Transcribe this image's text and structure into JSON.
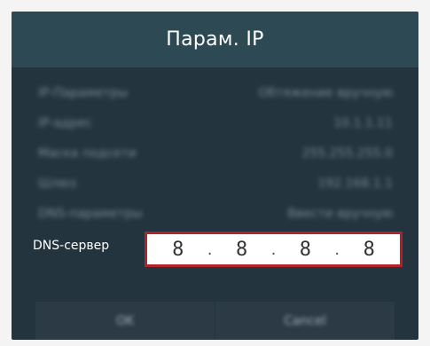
{
  "dialog": {
    "title": "Парам. IP",
    "rows": [
      {
        "label": "IP-Параметры",
        "value": "Обтяжение вручную"
      },
      {
        "label": "IP-адрес",
        "value": "10.1.1.11"
      },
      {
        "label": "Маска подсети",
        "value": "255.255.255.0"
      },
      {
        "label": "Шлюз",
        "value": "192.168.1.1"
      },
      {
        "label": "DNS-параметры",
        "value": "Ввести вручную"
      }
    ],
    "dns": {
      "label": "DNS-сервер",
      "octets": [
        "8",
        "8",
        "8",
        "8"
      ],
      "separator": "."
    },
    "buttons": {
      "ok": "OK",
      "cancel": "Cancel"
    }
  },
  "colors": {
    "dialog_bg": "#23343f",
    "header_bg": "#2d4a54",
    "focus_border": "#b0232a"
  }
}
